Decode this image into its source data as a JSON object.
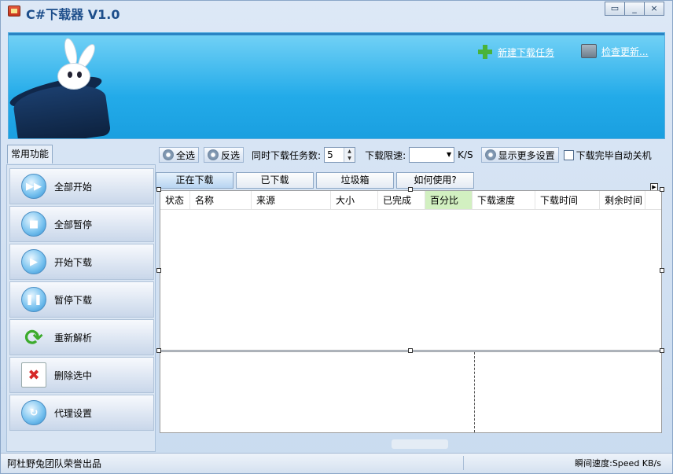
{
  "window": {
    "title": "C#下载器 V1.0",
    "buttons": [
      "▭",
      "_",
      "×"
    ]
  },
  "banner": {
    "new_task": "新建下载任务",
    "check_update": "检查更新..."
  },
  "sidebar": {
    "tab_label": "常用功能",
    "items": [
      {
        "label": "全部开始",
        "icon": "▶▶"
      },
      {
        "label": "全部暂停",
        "icon": "■"
      },
      {
        "label": "开始下载",
        "icon": "▶"
      },
      {
        "label": "暂停下载",
        "icon": "❚❚"
      },
      {
        "label": "重新解析",
        "icon": "⟳"
      },
      {
        "label": "删除选中",
        "icon": "✖"
      },
      {
        "label": "代理设置",
        "icon": "↻"
      }
    ]
  },
  "toolbar": {
    "select_all": "全选",
    "invert": "反选",
    "concurrent_label": "同时下载任务数:",
    "concurrent_value": "5",
    "speed_limit_label": "下载限速:",
    "speed_unit": "K/S",
    "more_settings": "显示更多设置",
    "auto_shutdown": "下载完毕自动关机"
  },
  "tabs": [
    "正在下载",
    "已下载",
    "垃圾箱",
    "如何使用?"
  ],
  "grid": {
    "columns": [
      "状态",
      "名称",
      "来源",
      "大小",
      "已完成",
      "百分比",
      "下载速度",
      "下载时间",
      "剩余时间"
    ]
  },
  "statusbar": {
    "left": "阿杜野兔团队荣誉出品",
    "right": "瞬间速度:Speed KB/s"
  }
}
